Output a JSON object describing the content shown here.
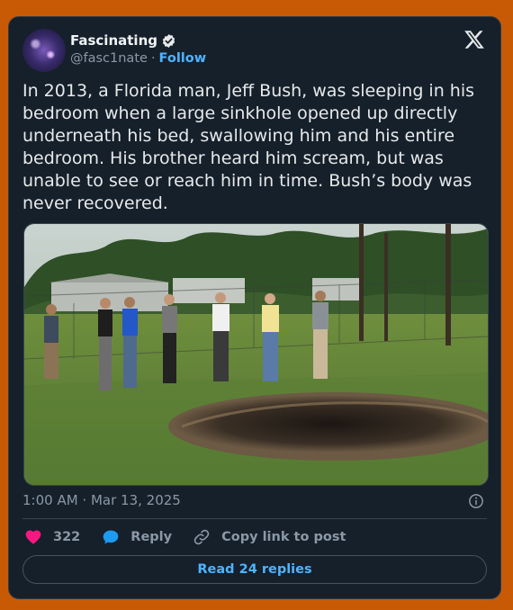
{
  "post": {
    "author_name": "Fascinating",
    "handle": "@fasc1nate",
    "separator": "·",
    "follow_label": "Follow",
    "verified": true,
    "text": "In 2013, a Florida man, Jeff Bush, was sleeping in his bedroom when a large sinkhole opened up directly underneath his bed, swallowing him and his entire bedroom. His brother heard him scream, but was unable to see or reach him in time. Bush’s body was never recovered.",
    "timestamp": "1:00 AM · Mar 13, 2025"
  },
  "actions": {
    "like_count": "322",
    "reply_label": "Reply",
    "copy_link_label": "Copy link to post"
  },
  "footer": {
    "read_replies_label": "Read 24 replies"
  },
  "icons": {
    "logo": "x-logo-icon",
    "verified": "verified-badge-icon",
    "info": "info-icon",
    "like": "heart-icon",
    "reply": "speech-bubble-icon",
    "copy_link": "link-icon"
  },
  "colors": {
    "page_background": "#c85a06",
    "card_background": "#15202b",
    "link_blue": "#4fb3ff",
    "heart_pink": "#f91880",
    "reply_blue": "#1d9bf0",
    "muted_text": "#8b98a5"
  }
}
